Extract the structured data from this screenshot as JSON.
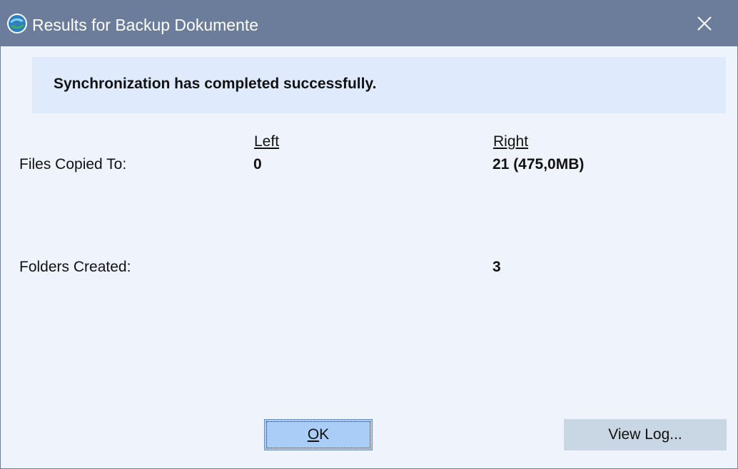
{
  "window": {
    "title": "Results for Backup Dokumente",
    "app_icon": "sync-app-icon",
    "close_icon": "close-icon"
  },
  "banner": {
    "message": "Synchronization has completed successfully."
  },
  "columns": {
    "left": "Left",
    "right": "Right"
  },
  "rows": [
    {
      "label": "Files Copied To:",
      "left": "0",
      "right": "21 (475,0MB)"
    },
    {
      "label": "Folders Created:",
      "left": "",
      "right": "3"
    }
  ],
  "buttons": {
    "ok_prefix": "O",
    "ok_rest": "K",
    "view_log": "View Log..."
  },
  "colors": {
    "titlebar": "#6b7d9a",
    "background": "#eff4fc",
    "banner": "#dfeafc",
    "ok_button": "#a9cdf7",
    "secondary_button": "#c9d6e4"
  }
}
